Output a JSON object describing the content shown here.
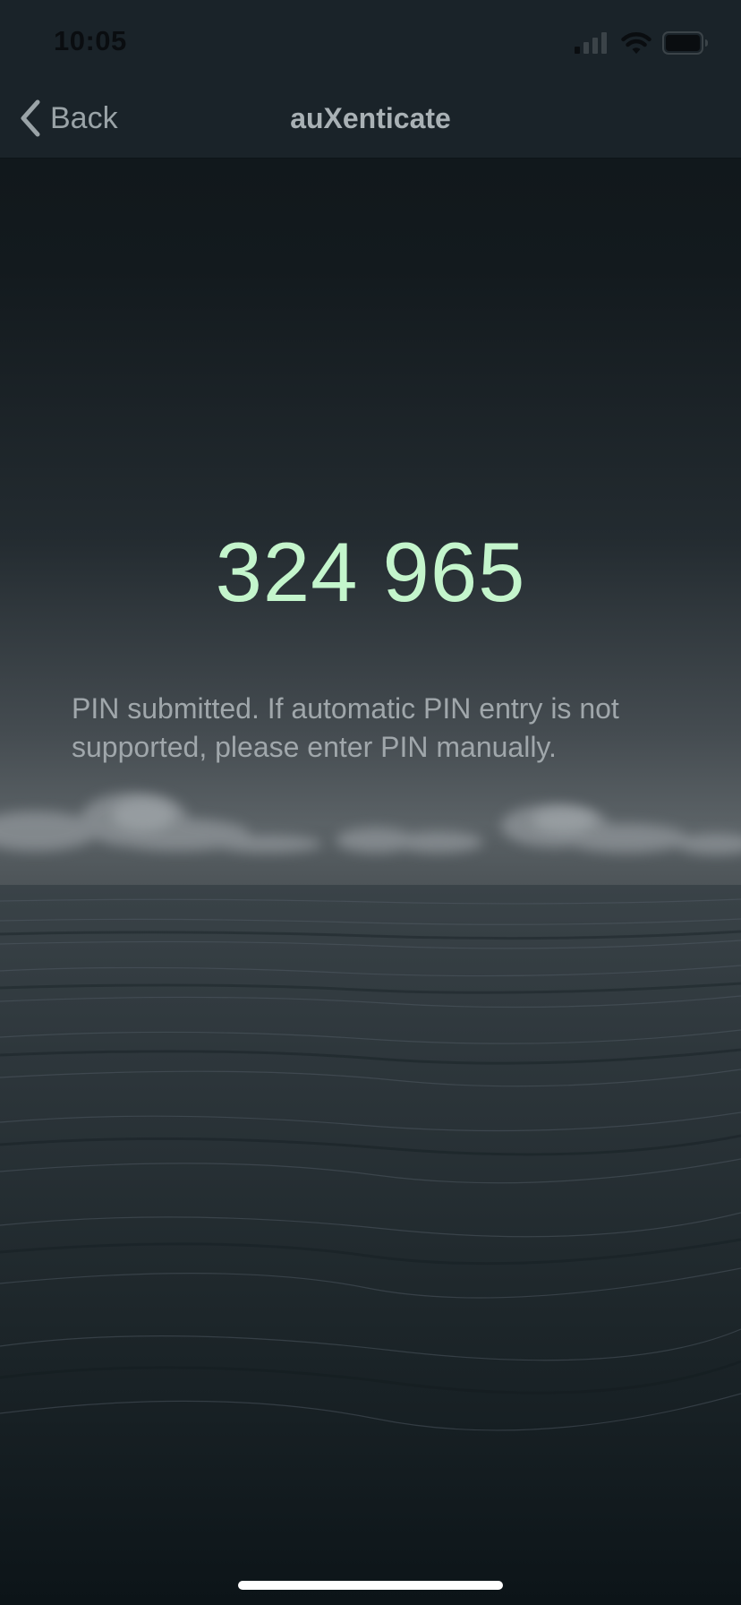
{
  "status_bar": {
    "time": "10:05",
    "icons": [
      "cellular-signal-icon",
      "wifi-icon",
      "battery-icon"
    ]
  },
  "nav": {
    "back_label": "Back",
    "title": "auXenticate",
    "back_icon": "chevron-left-icon"
  },
  "main": {
    "pin": "324 965",
    "message": "PIN submitted. If automatic PIN entry is not supported, please enter PIN manually."
  },
  "colors": {
    "pin_text": "#c4f5cc",
    "header_bg": "#1a2329",
    "message_text": "#a0a7ab"
  },
  "background_image": "ocean-horizon-with-clouds"
}
